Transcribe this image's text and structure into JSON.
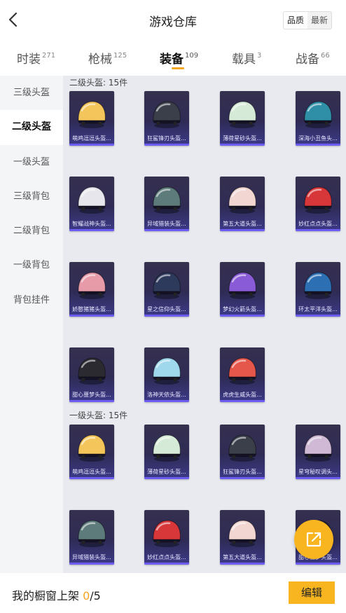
{
  "header": {
    "title": "游戏仓库",
    "sort_options": [
      "品质",
      "最新"
    ],
    "active_sort": 0
  },
  "tabs": [
    {
      "label": "时装",
      "count": "271"
    },
    {
      "label": "枪械",
      "count": "125"
    },
    {
      "label": "装备",
      "count": "109"
    },
    {
      "label": "载具",
      "count": "3"
    },
    {
      "label": "战备",
      "count": "66"
    }
  ],
  "active_tab": 2,
  "sidebar": {
    "items": [
      "三级头盔",
      "二级头盔",
      "一级头盔",
      "三级背包",
      "二级背包",
      "一级背包",
      "背包挂件"
    ],
    "active": 1
  },
  "sections": [
    {
      "title": "二级头盔: 15件",
      "items": [
        {
          "name": "萌鸡逗逗头盔...",
          "icon": "yellow-chick-helmet",
          "color": "#f3c55a"
        },
        {
          "name": "狂鲨锋刃头盔...",
          "icon": "shark-helmet",
          "color": "#3a3f4a"
        },
        {
          "name": "薄荷星砂头盔...",
          "icon": "mint-helmet",
          "color": "#d6ead8"
        },
        {
          "name": "深海小丑鱼头...",
          "icon": "clownfish-helmet",
          "color": "#2f8fa6"
        },
        {
          "name": "智耀战神头盔...",
          "icon": "silver-helmet",
          "color": "#e7e6ec"
        },
        {
          "name": "异域猎装头盔...",
          "icon": "teal-helmet",
          "color": "#5d7b7a"
        },
        {
          "name": "第五大道头盔...",
          "icon": "pink-helmet",
          "color": "#f1d6d2"
        },
        {
          "name": "妙红点点头盔...",
          "icon": "red-dot-helmet",
          "color": "#d8373a"
        },
        {
          "name": "娇憨猪猪头盔...",
          "icon": "pig-helmet",
          "color": "#e79aa8"
        },
        {
          "name": "星之信仰头盔...",
          "icon": "star-faith-helmet",
          "color": "#2e3a5c"
        },
        {
          "name": "梦幻火箭头盔...",
          "icon": "rocket-helmet",
          "color": "#8a5bd6"
        },
        {
          "name": "环太平洋头盔...",
          "icon": "pacific-helmet",
          "color": "#2c6fb3"
        },
        {
          "name": "甜心噩梦头盔...",
          "icon": "nightmare-helmet",
          "color": "#2a2a30"
        },
        {
          "name": "洛神天依头盔...",
          "icon": "tianyi-helmet",
          "color": "#9fd8ec"
        },
        {
          "name": "虎虎生威头盔...",
          "icon": "tiger-helmet",
          "color": "#e5574a"
        }
      ]
    },
    {
      "title": "一级头盔: 15件",
      "items": [
        {
          "name": "萌鸡逗逗头盔...",
          "icon": "yellow-chick-helmet",
          "color": "#f3c55a"
        },
        {
          "name": "薄荷星砂头盔...",
          "icon": "mint-helmet",
          "color": "#d6ead8"
        },
        {
          "name": "狂鲨锋刃头盔...",
          "icon": "shark-helmet",
          "color": "#3a3f4a"
        },
        {
          "name": "星穹秘叹调头...",
          "icon": "starry-helmet",
          "color": "#cfb9d4"
        },
        {
          "name": "异域猎装头盔...",
          "icon": "teal-helmet",
          "color": "#5d7b7a"
        },
        {
          "name": "妙红点点头盔...",
          "icon": "red-dot-helmet",
          "color": "#d8373a"
        },
        {
          "name": "第五大道头盔...",
          "icon": "pink-helmet",
          "color": "#f1d6d2"
        },
        {
          "name": "甜心噩梦头盔...",
          "icon": "nightmare-helmet",
          "color": "#2a2a30"
        }
      ]
    }
  ],
  "bottom": {
    "shelf_label": "我的橱窗上架 ",
    "shelf_count": "0",
    "shelf_total": "/5",
    "edit_label": "编辑"
  },
  "fab": {
    "icon": "share-icon"
  },
  "colors": {
    "accent": "#f8b520",
    "card_bar": "#6d5cf0"
  }
}
